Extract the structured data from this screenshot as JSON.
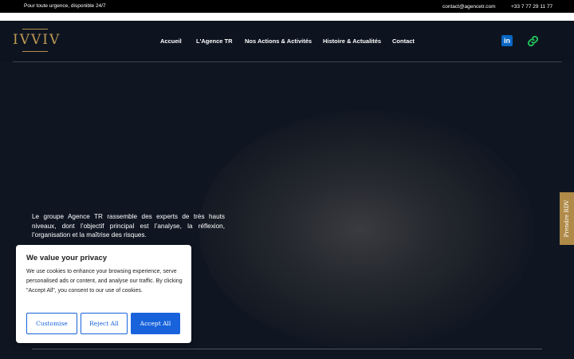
{
  "topbar": {
    "urgency_text": "Pour toute urgence, disponible 24/7",
    "email": "contact@agencetr.com",
    "phone": "+33 7 77 29 11 77"
  },
  "header": {
    "logo_text": "IVVIV",
    "nav": [
      {
        "label": "Accueil"
      },
      {
        "label": "L'Agence TR"
      },
      {
        "label": "Nos Actions & Activités"
      },
      {
        "label": "Histoire & Actualités"
      },
      {
        "label": "Contact"
      }
    ],
    "social": [
      {
        "icon": "linkedin-icon",
        "glyph": "in",
        "color": "#0a66c2"
      },
      {
        "icon": "link-icon",
        "color": "#22c55e"
      }
    ]
  },
  "hero": {
    "description": "Le groupe Agence TR rassemble des experts de très hauts niveaux, dont l’objectif principal est l’analyse, la réflexion, l’organisation et la maîtrise des risques."
  },
  "side_tab": {
    "label": "Prendre RDV"
  },
  "cookie_banner": {
    "title": "We value your privacy",
    "body": "We use cookies to enhance your browsing experience, serve personalised ads or content, and analyse our traffic. By clicking \"Accept All\", you consent to our use of cookies.",
    "customise_label": "Customise",
    "reject_label": "Reject All",
    "accept_label": "Accept All",
    "accent_color": "#1863dc"
  },
  "colors": {
    "background": "#0e1521",
    "gold": "#c19a52"
  }
}
